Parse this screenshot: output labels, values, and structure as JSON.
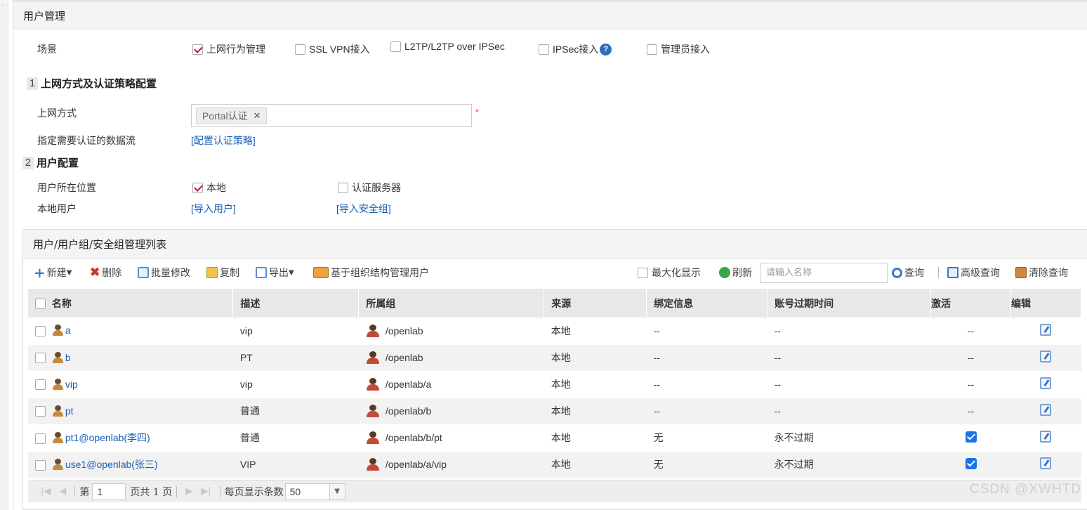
{
  "panel": {
    "title": "用户管理"
  },
  "scenario": {
    "label": "场景",
    "options": [
      {
        "label": "上网行为管理",
        "checked": true
      },
      {
        "label": "SSL VPN接入",
        "checked": false
      },
      {
        "label": "L2TP/L2TP over IPSec",
        "checked": false
      },
      {
        "label": "IPSec接入",
        "checked": false
      },
      {
        "label": "管理员接入",
        "checked": false
      }
    ],
    "help_icon": "?"
  },
  "section1": {
    "number": "1",
    "title": "上网方式及认证策略配置",
    "access_label": "上网方式",
    "access_tag": "Portal认证",
    "tag_remove": "✕",
    "required_mark": "*",
    "flow_label": "指定需要认证的数据流",
    "flow_link": "[配置认证策略]"
  },
  "section2": {
    "number": "2",
    "title": "用户配置",
    "location_label": "用户所在位置",
    "location_local": "本地",
    "location_server": "认证服务器",
    "local_user_label": "本地用户",
    "import_users": "[导入用户]",
    "import_groups": "[导入安全组]"
  },
  "list": {
    "title": "用户/用户组/安全组管理列表",
    "toolbar": {
      "new": "新建",
      "delete": "删除",
      "batch_edit": "批量修改",
      "copy": "复制",
      "export": "导出",
      "org_manage": "基于组织结构管理用户",
      "maximize": "最大化显示",
      "refresh": "刷新",
      "search_placeholder": "请输入名称",
      "query": "查询",
      "advanced_query": "高级查询",
      "clear_query": "清除查询"
    },
    "columns": [
      "名称",
      "描述",
      "所属组",
      "来源",
      "绑定信息",
      "账号过期时间",
      "激活",
      "编辑"
    ],
    "rows": [
      {
        "name": "a",
        "desc": "vip",
        "group": "/openlab",
        "source": "本地",
        "bind": "--",
        "expire": "--",
        "active": "--"
      },
      {
        "name": "b",
        "desc": "PT",
        "group": "/openlab",
        "source": "本地",
        "bind": "--",
        "expire": "--",
        "active": "--"
      },
      {
        "name": "vip",
        "desc": "vip",
        "group": "/openlab/a",
        "source": "本地",
        "bind": "--",
        "expire": "--",
        "active": "--"
      },
      {
        "name": "pt",
        "desc": "普通",
        "group": "/openlab/b",
        "source": "本地",
        "bind": "--",
        "expire": "--",
        "active": "--"
      },
      {
        "name": "pt1@openlab(李四)",
        "desc": "普通",
        "group": "/openlab/b/pt",
        "source": "本地",
        "bind": "无",
        "expire": "永不过期",
        "active": "checked"
      },
      {
        "name": "use1@openlab(张三)",
        "desc": "VIP",
        "group": "/openlab/a/vip",
        "source": "本地",
        "bind": "无",
        "expire": "永不过期",
        "active": "checked"
      }
    ]
  },
  "pager": {
    "page_prefix": "第",
    "page_value": "1",
    "page_suffix": "页共 1 页",
    "per_page_label": "每页显示条数",
    "per_page_value": "50"
  },
  "watermark": "CSDN @XWHTD"
}
